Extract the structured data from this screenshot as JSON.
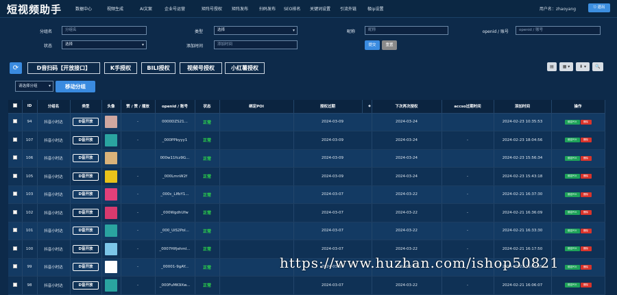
{
  "header": {
    "logo": "短视频助手",
    "nav": [
      "数据中心",
      "视频生成",
      "AI文案",
      "企业号运营",
      "矩阵号授权",
      "矩阵发布",
      "扫码发布",
      "SEO排名",
      "关键词设置",
      "引流外链",
      "极ip设置"
    ],
    "user_label": "用户名：zhaoyang",
    "logout": "退出"
  },
  "filters": {
    "group_label": "分组名",
    "group_placeholder": "分组名",
    "type_label": "类型",
    "type_value": "选择",
    "nickname_label": "昵称",
    "nickname_placeholder": "昵称",
    "openid_label": "openid / 账号",
    "openid_placeholder": "openid / 账号",
    "status_label": "状态",
    "status_value": "选择",
    "add_time_label": "添加时间",
    "add_time_placeholder": "添加时间",
    "submit": "提交",
    "reset": "重置"
  },
  "actions": {
    "refresh_icon": "refresh-icon",
    "buttons": [
      "D音扫码【开放接口】",
      "K手授权",
      "BILI授权",
      "视频号授权",
      "小红薯授权"
    ],
    "tools": [
      "▤",
      "▦ ▾",
      "⬇ ▾",
      "🔍"
    ]
  },
  "group_move": {
    "select_placeholder": "请选择分组",
    "move_button": "移动分组"
  },
  "table": {
    "headers": [
      "",
      "ID",
      "分组名",
      "类型",
      "头像",
      "赞 / 赞 / 播放",
      "openid / 账号",
      "状态",
      "绑定POI",
      "授权过期",
      "",
      "下次再次授权",
      "accso过期时间",
      "添加时间",
      "操作"
    ],
    "edit_label": "绑定POI",
    "delete_label": "删除",
    "rows": [
      {
        "id": "94",
        "group": "抖音小时达",
        "type": "D音开放",
        "avatar": "#cfa7a0",
        "likes": "-",
        "openid": "0000DZS21...",
        "status": "正常",
        "poi": "",
        "expire": "2024-03-09",
        "next": "2024-03-24",
        "access": "",
        "added": "2024-02-23 10:35:53"
      },
      {
        "id": "107",
        "group": "抖音小时达",
        "type": "D音开放",
        "avatar": "#2aa4a0",
        "likes": "-",
        "openid": "_000PPbyyy1",
        "status": "正常",
        "poi": "",
        "expire": "2024-03-09",
        "next": "2024-03-24",
        "access": "-",
        "added": "2024-02-23 18:04:56"
      },
      {
        "id": "106",
        "group": "抖音小时达",
        "type": "D音开放",
        "avatar": "#d9b27a",
        "likes": "",
        "openid": "000w11fcz9G...",
        "status": "正常",
        "poi": "",
        "expire": "2024-03-09",
        "next": "2024-03-24",
        "access": "",
        "added": "2024-02-23 15:56:34"
      },
      {
        "id": "105",
        "group": "抖音小时达",
        "type": "D音开放",
        "avatar": "#e8c21a",
        "likes": "-",
        "openid": "_000LmnW2f",
        "status": "正常",
        "poi": "",
        "expire": "2024-03-09",
        "next": "2024-03-24",
        "access": "-",
        "added": "2024-02-23 15:43:18"
      },
      {
        "id": "103",
        "group": "抖音小时达",
        "type": "D音开放",
        "avatar": "#e2407a",
        "likes": "-",
        "openid": "_000c_LIfbY1...",
        "status": "正常",
        "poi": "",
        "expire": "2024-03-07",
        "next": "2024-03-22",
        "access": "-",
        "added": "2024-02-21 16:37:30"
      },
      {
        "id": "102",
        "group": "抖音小时达",
        "type": "D音开放",
        "avatar": "#d83a6e",
        "likes": "-",
        "openid": "_000WgdhUfw",
        "status": "正常",
        "poi": "",
        "expire": "2024-03-07",
        "next": "2024-03-22",
        "access": "-",
        "added": "2024-02-21 16:36:09"
      },
      {
        "id": "101",
        "group": "抖音小时达",
        "type": "D音开放",
        "avatar": "#2aa4a0",
        "likes": "-",
        "openid": "_000_UiS2Pol...",
        "status": "正常",
        "poi": "",
        "expire": "2024-03-07",
        "next": "2024-03-22",
        "access": "-",
        "added": "2024-02-21 16:33:30"
      },
      {
        "id": "100",
        "group": "抖音小时达",
        "type": "D音开放",
        "avatar": "#7cc6e8",
        "likes": "-",
        "openid": "_0007HIfjehml...",
        "status": "正常",
        "poi": "",
        "expire": "2024-03-07",
        "next": "2024-03-22",
        "access": "-",
        "added": "2024-02-21 16:17:50"
      },
      {
        "id": "99",
        "group": "抖音小时达",
        "type": "D音开放",
        "avatar": "#ffffff",
        "likes": "-",
        "openid": "_00001-9gAY...",
        "status": "正常",
        "poi": "",
        "expire": "2024-03-07",
        "next": "2024-03-22",
        "access": "-",
        "added": "2024-02-21 16:07:35"
      },
      {
        "id": "98",
        "group": "抖音小时达",
        "type": "D音开放",
        "avatar": "#2aa4a0",
        "likes": "-",
        "openid": "_000FuMK9Xw...",
        "status": "正常",
        "poi": "",
        "expire": "2024-03-07",
        "next": "2024-03-22",
        "access": "-",
        "added": "2024-02-21 16:06:07"
      }
    ]
  },
  "watermark": "https://www.huzhan.com/ishop50821"
}
